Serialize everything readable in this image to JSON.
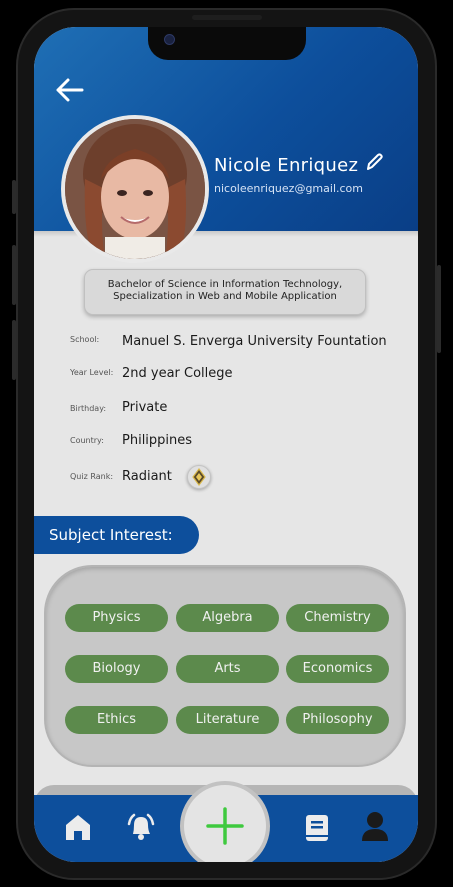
{
  "profile": {
    "name": "Nicole Enriquez",
    "email": "nicoleenriquez@gmail.com",
    "degree_line1": "Bachelor of Science in Information Technology,",
    "degree_line2": "Specialization in Web and Mobile Application"
  },
  "info": {
    "school_label": "School:",
    "school_value": "Manuel S. Enverga University Fountation",
    "year_label": "Year Level:",
    "year_value": "2nd year College",
    "birthday_label": "Birthday:",
    "birthday_value": "Private",
    "country_label": "Country:",
    "country_value": "Philippines",
    "rank_label": "Quiz Rank:",
    "rank_value": "Radiant"
  },
  "subjects": {
    "heading": "Subject Interest:",
    "chips": [
      "Physics",
      "Algebra",
      "Chemistry",
      "Biology",
      "Arts",
      "Economics",
      "Ethics",
      "Literature",
      "Philosophy"
    ]
  },
  "nav": {
    "items": [
      "home-icon",
      "notifications-icon",
      "add-icon",
      "book-icon",
      "profile-icon"
    ],
    "active_color": "#0d4f9c",
    "add_color": "#3ec93e"
  },
  "colors": {
    "header": "#0d4f9c",
    "chip": "#5c8a4c"
  }
}
